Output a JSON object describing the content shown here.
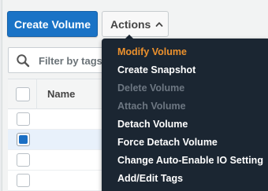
{
  "toolbar": {
    "create_label": "Create Volume",
    "actions_label": "Actions"
  },
  "filter": {
    "placeholder": "Filter by tags"
  },
  "table": {
    "columns": [
      "Name"
    ],
    "rows": [
      {
        "selected": false
      },
      {
        "selected": true
      },
      {
        "selected": false
      },
      {
        "selected": false
      }
    ]
  },
  "actions_menu": {
    "items": [
      {
        "label": "Modify Volume",
        "state": "active"
      },
      {
        "label": "Create Snapshot",
        "state": "enabled"
      },
      {
        "label": "Delete Volume",
        "state": "disabled"
      },
      {
        "label": "Attach Volume",
        "state": "disabled"
      },
      {
        "label": "Detach Volume",
        "state": "enabled"
      },
      {
        "label": "Force Detach Volume",
        "state": "enabled"
      },
      {
        "label": "Change Auto-Enable IO Setting",
        "state": "enabled"
      },
      {
        "label": "Add/Edit Tags",
        "state": "enabled"
      }
    ]
  },
  "colors": {
    "primary": "#1a73c6",
    "menu_bg": "#1b2632",
    "menu_active": "#ec912d",
    "menu_disabled": "#6d7782"
  },
  "icons": {
    "search": "search-icon",
    "chevron": "chevron-up-icon"
  }
}
